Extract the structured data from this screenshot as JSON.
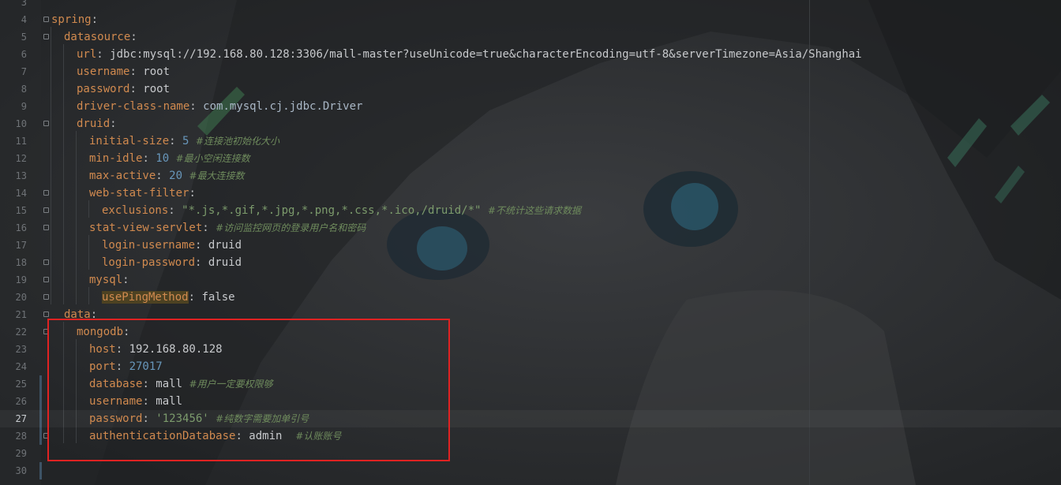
{
  "editor": {
    "line_numbers": [
      "3",
      "4",
      "5",
      "6",
      "7",
      "8",
      "9",
      "10",
      "11",
      "12",
      "13",
      "14",
      "15",
      "16",
      "17",
      "18",
      "19",
      "20",
      "21",
      "22",
      "23",
      "24",
      "25",
      "26",
      "27",
      "28",
      "29",
      "30"
    ],
    "current_line": "27",
    "lines": [
      {
        "key": "",
        "value": ""
      },
      {
        "key": "spring",
        "value": ""
      },
      {
        "key": "datasource",
        "value": ""
      },
      {
        "key": "url",
        "value": "jdbc:mysql://192.168.80.128:3306/mall-master?useUnicode=true&characterEncoding=utf-8&serverTimezone=Asia/Shanghai"
      },
      {
        "key": "username",
        "value": "root"
      },
      {
        "key": "password",
        "value": "root"
      },
      {
        "key": "driver-class-name",
        "value": "com.mysql.cj.jdbc.Driver"
      },
      {
        "key": "druid",
        "value": ""
      },
      {
        "key": "initial-size",
        "value": "5",
        "comment": "#连接池初始化大小"
      },
      {
        "key": "min-idle",
        "value": "10",
        "comment": "#最小空闲连接数"
      },
      {
        "key": "max-active",
        "value": "20",
        "comment": "#最大连接数"
      },
      {
        "key": "web-stat-filter",
        "value": ""
      },
      {
        "key": "exclusions",
        "value": "\"*.js,*.gif,*.jpg,*.png,*.css,*.ico,/druid/*\"",
        "comment": "#不统计这些请求数据"
      },
      {
        "key": "stat-view-servlet",
        "value": "",
        "comment": "#访问监控网页的登录用户名和密码"
      },
      {
        "key": "login-username",
        "value": "druid"
      },
      {
        "key": "login-password",
        "value": "druid"
      },
      {
        "key": "mysql",
        "value": ""
      },
      {
        "key": "usePingMethod",
        "value": "false"
      },
      {
        "key": "data",
        "value": ""
      },
      {
        "key": "mongodb",
        "value": ""
      },
      {
        "key": "host",
        "value": "192.168.80.128"
      },
      {
        "key": "port",
        "value": "27017"
      },
      {
        "key": "database",
        "value": "mall",
        "comment": "#用户一定要权限够"
      },
      {
        "key": "username",
        "value": "mall"
      },
      {
        "key": "password",
        "value": "'123456'",
        "comment": "#纯数字需要加单引号"
      },
      {
        "key": "authenticationDatabase",
        "value": "admin",
        "comment": "#认账账号"
      },
      {
        "key": "",
        "value": ""
      },
      {
        "key": "",
        "value": ""
      }
    ],
    "colors": {
      "key": "#d18a4f",
      "string": "#7c9b6c",
      "number": "#6897bb",
      "comment": "#6f8c5d",
      "highlight_box": "#e02222"
    }
  }
}
